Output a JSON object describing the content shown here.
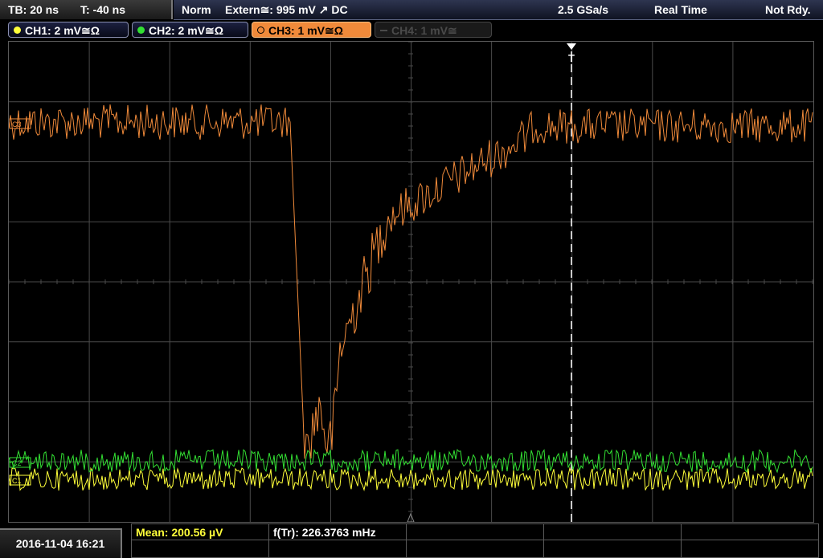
{
  "topbar": {
    "timebase": "TB: 20 ns",
    "trigger_offset": "T: -40 ns",
    "acq_mode": "Norm",
    "trigger_source": "Extern≅: 995 mV ↗ DC",
    "sample_rate": "2.5 GSa/s",
    "realtime": "Real Time",
    "status": "Not Rdy."
  },
  "channels": [
    {
      "label": "CH1: 2 mV≅Ω",
      "color": "#ffff3a"
    },
    {
      "label": "CH2: 2 mV≅Ω",
      "color": "#33e033"
    },
    {
      "label": "CH3: 1 mV≅Ω",
      "color": "#f08a3a"
    },
    {
      "label": "CH4: 1 mV≅",
      "color": "#4a4a4a"
    }
  ],
  "markers": {
    "trigger_letter": "T",
    "ch3_level": "C3",
    "ch2_level": "C2",
    "ch1_level": "C1"
  },
  "bottom": {
    "datetime": "2016-11-04 16:21",
    "mean": "Mean: 200.56 µV",
    "freq": "f(Tr): 226.3763 mHz"
  },
  "colors": {
    "grid": "#4a4a4a",
    "ch1": "#ffff3a",
    "ch2": "#33e033",
    "ch3": "#f08a3a",
    "trigger": "#ffffff"
  }
}
